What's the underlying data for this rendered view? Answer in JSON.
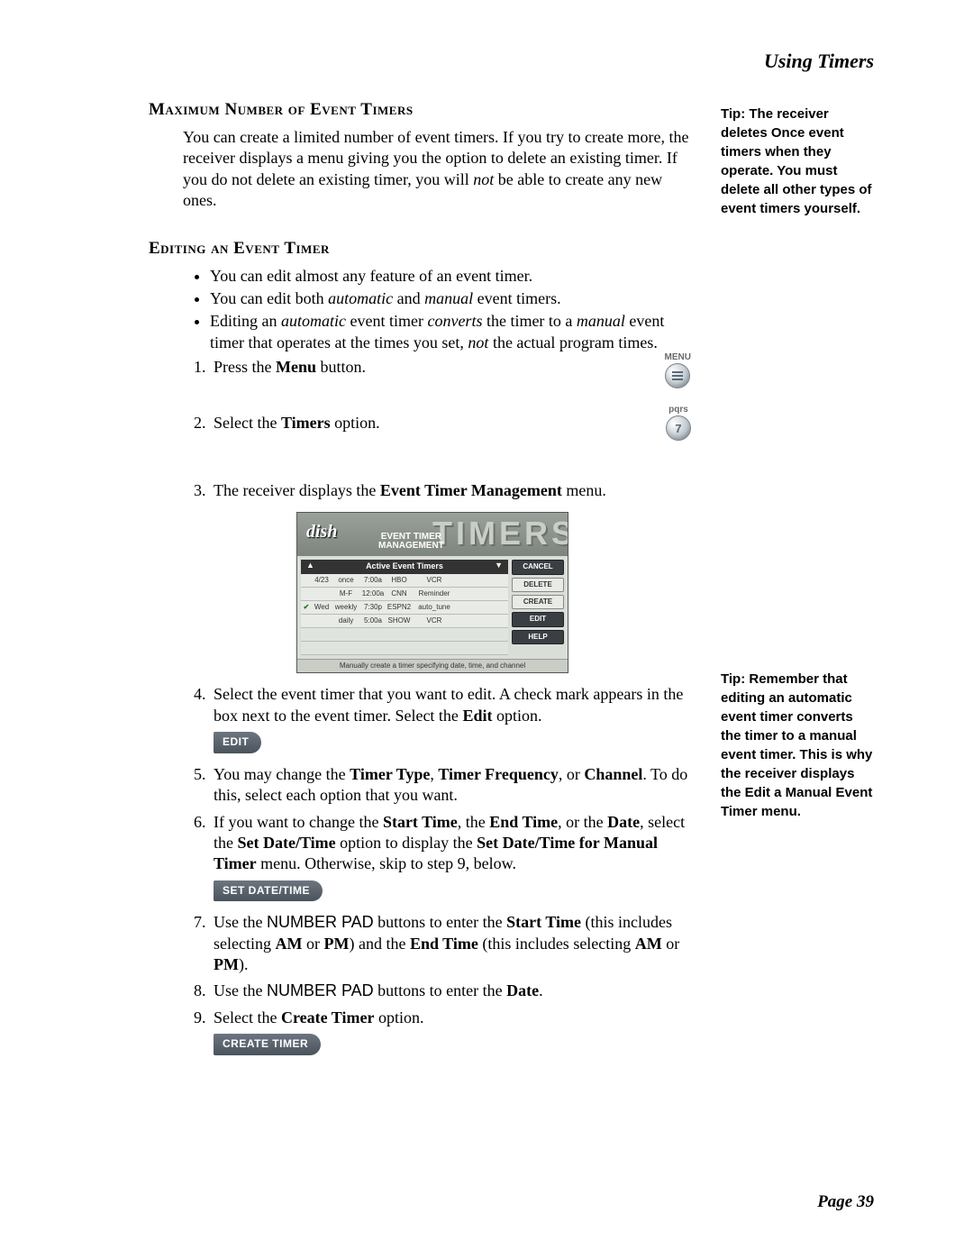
{
  "header": {
    "title": "Using Timers"
  },
  "section1": {
    "heading": "Maximum Number of Event Timers",
    "para_parts": {
      "p1": "You can create a limited number of event timers. If you try to create more, the receiver displays a menu giving you the option to delete an existing timer. If you do not delete an existing timer, you will ",
      "p2": "not",
      "p3": " be able to create any new ones."
    }
  },
  "section2": {
    "heading": "Editing an Event Timer",
    "bullets": {
      "b1": "You can edit almost any feature of an event timer.",
      "b2a": "You can edit both ",
      "b2b": "automatic",
      "b2c": " and ",
      "b2d": "manual",
      "b2e": " event timers.",
      "b3a": "Editing an ",
      "b3b": "automatic",
      "b3c": " event timer ",
      "b3d": "converts",
      "b3e": " the timer to a ",
      "b3f": "manual",
      "b3g": " event timer that operates at the times you set, ",
      "b3h": "not",
      "b3i": " the actual program times."
    },
    "steps": {
      "s1a": "Press the ",
      "s1b": "Menu",
      "s1c": " button.",
      "s2a": "Select the ",
      "s2b": "Timers",
      "s2c": " option.",
      "s3a": "The receiver displays the ",
      "s3b": "Event Timer Management",
      "s3c": " menu.",
      "s4a": "Select the event timer that you want to edit. A check mark appears in the box next to the event timer. Select the ",
      "s4b": "Edit",
      "s4c": " option.",
      "edit_btn": "EDIT",
      "s5a": "You may change the ",
      "s5b": "Timer Type",
      "s5c": ", ",
      "s5d": "Timer Frequency",
      "s5e": ", or ",
      "s5f": "Channel",
      "s5g": ". To do this, select each option that you want.",
      "s6a": "If you want to change the ",
      "s6b": "Start Time",
      "s6c": ", the ",
      "s6d": "End Time",
      "s6e": ", or the ",
      "s6f": "Date",
      "s6g": ", select the ",
      "s6h": "Set Date/Time",
      "s6i": " option to display the ",
      "s6j": "Set Date/Time for Manual Timer",
      "s6k": " menu. Otherwise, skip to step 9, below.",
      "setdate_btn": "SET DATE/TIME",
      "s7a": "Use the ",
      "s7b": "NUMBER PAD",
      "s7c": " buttons to enter the ",
      "s7d": "Start Time",
      "s7e": " (this includes selecting ",
      "s7f": "AM",
      "s7g": " or ",
      "s7h": "PM",
      "s7i": ") and the ",
      "s7j": "End Time",
      "s7k": " (this includes selecting ",
      "s7l": "AM",
      "s7m": " or ",
      "s7n": "PM",
      "s7o": ").",
      "s8a": "Use the ",
      "s8b": "NUMBER PAD",
      "s8c": " buttons to enter the ",
      "s8d": "Date",
      "s8e": ".",
      "s9a": "Select the ",
      "s9b": "Create Timer",
      "s9c": " option.",
      "create_btn": "CREATE TIMER"
    }
  },
  "side_icons": {
    "menu_label": "MENU",
    "pqrs_label": "pqrs",
    "seven": "7"
  },
  "screenshot": {
    "logo": "dish",
    "big": "TIMERS",
    "sub1": "EVENT TIMER",
    "sub2": "MANAGEMENT",
    "table_header": "Active Event Timers",
    "rows": [
      {
        "check": "",
        "date": "4/23",
        "freq": "once",
        "time": "7:00a",
        "ch": "HBO",
        "type": "VCR"
      },
      {
        "check": "",
        "date": "",
        "freq": "M-F",
        "time": "12:00a",
        "ch": "CNN",
        "type": "Reminder"
      },
      {
        "check": "✔",
        "date": "Wed",
        "freq": "weekly",
        "time": "7:30p",
        "ch": "ESPN2",
        "type": "auto_tune"
      },
      {
        "check": "",
        "date": "",
        "freq": "daily",
        "time": "5:00a",
        "ch": "SHOW",
        "type": "VCR"
      }
    ],
    "buttons": [
      "CANCEL",
      "DELETE",
      "CREATE",
      "EDIT",
      "HELP"
    ],
    "footer": "Manually create a timer specifying date, time, and channel"
  },
  "tips": {
    "tip1": "Tip: The receiver deletes Once event timers when they operate. You must delete all other types of event timers yourself.",
    "tip2": "Tip: Remember that editing an automatic event timer converts the timer to a manual event timer. This is why the receiver displays the Edit a Manual Event Timer menu."
  },
  "footer": {
    "page": "Page 39"
  }
}
